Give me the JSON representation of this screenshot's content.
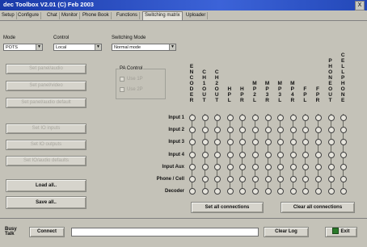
{
  "window": {
    "title": "dec Toolbox V2.01 (C) Feb 2003",
    "close_label": "X"
  },
  "tabs": [
    {
      "label": "Setup"
    },
    {
      "label": "Configure"
    },
    {
      "label": "Chat"
    },
    {
      "label": "Monitor"
    },
    {
      "label": "Phone Book"
    },
    {
      "label": "Functions"
    },
    {
      "label": "Switching matrix"
    },
    {
      "label": "Uploader"
    }
  ],
  "active_tab": "Switching matrix",
  "controls": {
    "mode_label": "Mode",
    "mode_value": "POTS",
    "control_label": "Control",
    "control_value": "Local",
    "switching_label": "Switching Mode",
    "switching_value": "Normal mode"
  },
  "left_buttons": [
    {
      "label": "Set panel/audio",
      "disabled": true
    },
    {
      "label": "Set panel/video",
      "disabled": true
    },
    {
      "label": "Set panel/audio default",
      "disabled": true
    },
    {
      "label": "Set IO inputs",
      "disabled": true
    },
    {
      "label": "Set IO outputs",
      "disabled": true
    },
    {
      "label": "Set IO/audio defaults",
      "disabled": true
    },
    {
      "label": "Load all..",
      "disabled": false
    },
    {
      "label": "Save all..",
      "disabled": false
    }
  ],
  "pa_control": {
    "title": "PA Control",
    "option1": "Use 1P",
    "option2": "Use 2P"
  },
  "matrix": {
    "columns": [
      "ENCODER",
      "CH 1 OUT",
      "CH 2 OUT",
      "HP L",
      "HP R",
      "MP2 L",
      "MP3 R",
      "MP3 L",
      "MP4 R",
      "FP L",
      "FP R",
      "PHONE OUT",
      "CELLPHONE"
    ],
    "rows": [
      "Input 1",
      "Input 2",
      "Input 3",
      "Input 4",
      "Input Aux",
      "Phone / Cell",
      "Decoder"
    ],
    "set_all_label": "Set all connections",
    "clear_all_label": "Clear all connections"
  },
  "statusbar": {
    "busy_label": "Busy Talk",
    "connect_label": "Connect",
    "clear_log_label": "Clear Log",
    "exit_label": "Exit"
  },
  "colors": {
    "titlebar": "#1a3aa8",
    "window_bg": "#c4c2b8"
  }
}
